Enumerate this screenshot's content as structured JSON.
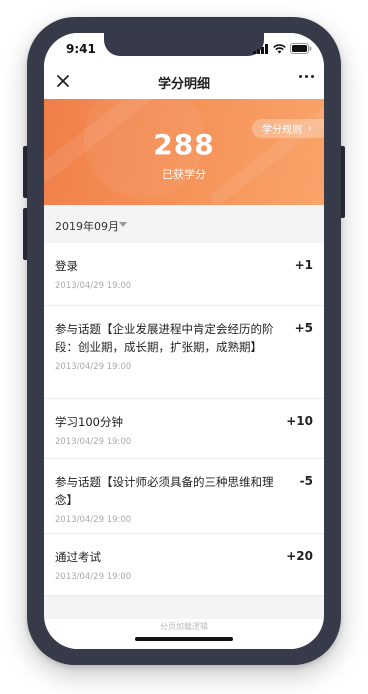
{
  "status_bar": {
    "time": "9:41"
  },
  "nav": {
    "title": "学分明细"
  },
  "banner": {
    "points": "288",
    "points_label": "已获学分",
    "rules_button": "学分规则"
  },
  "filter": {
    "month": "2019年09月"
  },
  "records": [
    {
      "title": "登录",
      "date": "2013/04/29 19:00",
      "delta": "+1"
    },
    {
      "title": "参与话题【企业发展进程中肯定会经历的阶段：创业期，成长期，扩张期，成熟期】",
      "date": "2013/04/29 19:00",
      "delta": "+5"
    },
    {
      "title": "学习100分钟",
      "date": "2013/04/29 19:00",
      "delta": "+10"
    },
    {
      "title": "参与话题【设计师必须具备的三种思维和理念】",
      "date": "2013/04/29 19:00",
      "delta": "-5"
    },
    {
      "title": "通过考试",
      "date": "2013/04/29 19:00",
      "delta": "+20"
    }
  ],
  "footer": {
    "note": "分页加载逻辑"
  },
  "colors": {
    "banner_start": "#f07f4a",
    "banner_end": "#f8a46a",
    "frame": "#363a49"
  },
  "icons": [
    "signal-icon",
    "wifi-icon",
    "battery-icon",
    "close-icon",
    "more-icon",
    "chevron-right-icon",
    "caret-down-icon"
  ]
}
